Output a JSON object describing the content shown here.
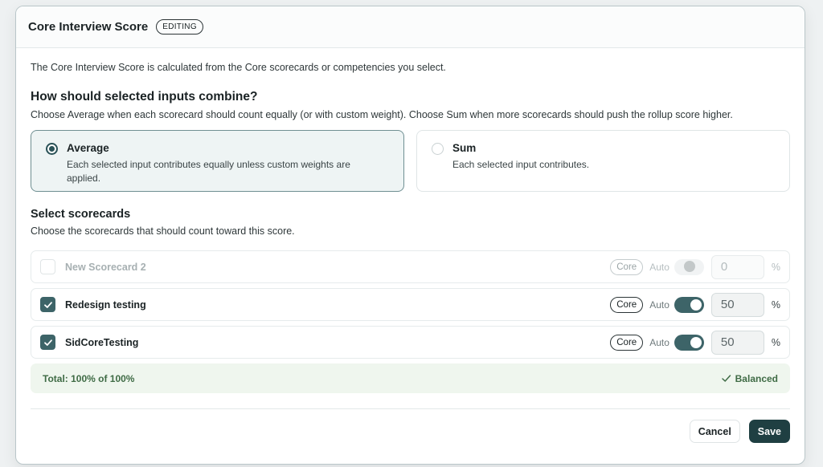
{
  "header": {
    "title": "Core Interview Score",
    "badge": "EDITING"
  },
  "intro": "The Core Interview Score is calculated from the Core scorecards or competencies you select.",
  "combine": {
    "heading": "How should selected inputs combine?",
    "description": "Choose Average when each scorecard should count equally (or with custom weight). Choose Sum when more scorecards should push the rollup score higher.",
    "options": [
      {
        "label": "Average",
        "description": "Each selected input contributes equally unless custom weights are applied.",
        "selected": true
      },
      {
        "label": "Sum",
        "description": "Each selected input contributes.",
        "selected": false
      }
    ]
  },
  "scorecards": {
    "heading": "Select scorecards",
    "description": "Choose the scorecards that should count toward this score.",
    "items": [
      {
        "name": "New Scorecard 2",
        "checked": false,
        "tag": "Core",
        "auto_label": "Auto",
        "auto_on": false,
        "weight": "0",
        "unit": "%"
      },
      {
        "name": "Redesign testing",
        "checked": true,
        "tag": "Core",
        "auto_label": "Auto",
        "auto_on": true,
        "weight": "50",
        "unit": "%"
      },
      {
        "name": "SidCoreTesting",
        "checked": true,
        "tag": "Core",
        "auto_label": "Auto",
        "auto_on": true,
        "weight": "50",
        "unit": "%"
      }
    ]
  },
  "total": {
    "text": "Total: 100% of 100%",
    "status": "Balanced"
  },
  "footer": {
    "cancel_label": "Cancel",
    "save_label": "Save"
  },
  "colors": {
    "accent": "#3d6468",
    "primary_button": "#1f3f42",
    "success_text": "#3f6b45",
    "success_bg": "#eff6ee"
  }
}
